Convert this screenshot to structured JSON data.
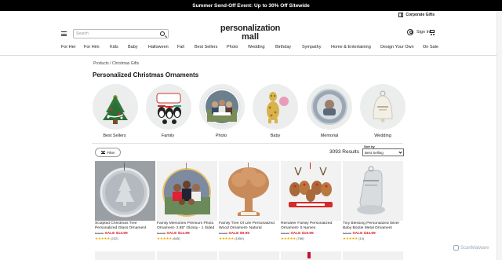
{
  "promo_bar": {
    "text": "Summer Send-Off Event: Up to 30% Off Sitewide"
  },
  "utility": {
    "corporate_gifts": "Corporate Gifts"
  },
  "header": {
    "logo_line1": "personalization",
    "logo_line2": "mall",
    "search_placeholder": "Search",
    "sign_in": "Sign In"
  },
  "nav": {
    "items": [
      "For Her",
      "For Him",
      "Kids",
      "Baby",
      "Halloween",
      "Fall",
      "Best Sellers",
      "Photo",
      "Wedding",
      "Birthday",
      "Sympathy",
      "Home & Entertaining",
      "Design Your Own",
      "On Sale"
    ]
  },
  "breadcrumb": {
    "text": "Products / Christmas Gifts"
  },
  "page": {
    "title": "Personalized Christmas Ornaments"
  },
  "categories": [
    {
      "label": "Best Sellers"
    },
    {
      "label": "Family"
    },
    {
      "label": "Photo"
    },
    {
      "label": "Baby"
    },
    {
      "label": "Memorial"
    },
    {
      "label": "Wedding"
    }
  ],
  "toolbar": {
    "filter_label": "Filter",
    "results_text": "3093 Results",
    "sort_label": "Sort by",
    "sort_value": "Best Selling"
  },
  "products": [
    {
      "name": "Sculpted Christmas Tree Personalized Glass Ornament",
      "orig_price": "$19.99",
      "sale_price": "SALE $14.99",
      "reviews": "(222)"
    },
    {
      "name": "Family Memories Premium Photo Ornament- 2.85\" Glossy - 1 Sided",
      "orig_price": "$19.99",
      "sale_price": "SALE $14.99",
      "reviews": "(845)"
    },
    {
      "name": "Family Tree Of Life Personalized Wood Ornament- Natural",
      "orig_price": "$13.99",
      "sale_price": "SALE $9.99",
      "reviews": "(1554)"
    },
    {
      "name": "Reindeer Family Personalized Ornament- 5 Names",
      "orig_price": "$26.99",
      "sale_price": "SALE $19.99",
      "reviews": "(786)"
    },
    {
      "name": "Tiny Blessing Personalized Silver Baby Bootie Metal Ornament",
      "orig_price": "$49.99",
      "sale_price": "SALE $44.99",
      "reviews": "(14)"
    }
  ],
  "watermark": {
    "text": "ScanMalware"
  },
  "colors": {
    "sale": "#d21f26",
    "stars": "#f2a900",
    "promo_bg": "#000000",
    "category_bg": "#eceded"
  },
  "icons": [
    "gift-icon",
    "menu-icon",
    "search-icon",
    "user-icon",
    "cart-icon",
    "filter-icon",
    "chevron-down-icon",
    "star-icon"
  ]
}
